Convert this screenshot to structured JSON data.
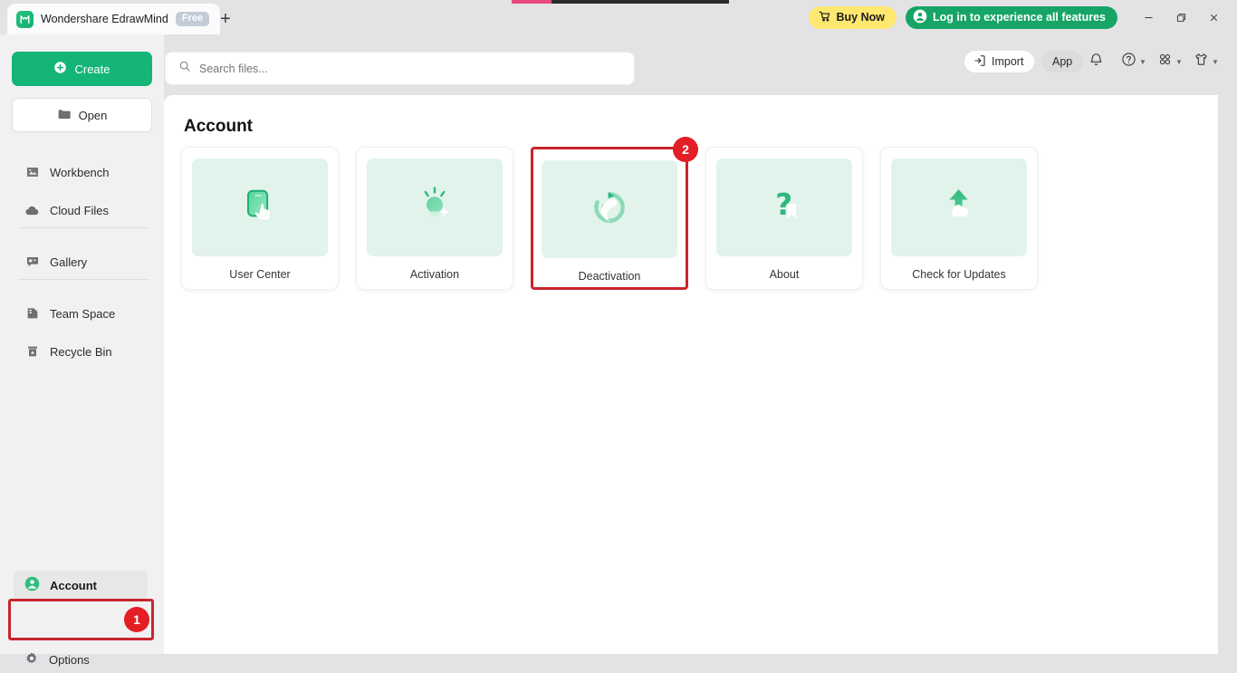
{
  "window": {
    "tab_title": "Wondershare EdrawMind",
    "tab_badge": "Free",
    "new_tab_label": "+",
    "logo_icon": "edrawmind-logo-icon",
    "buy_now_label": "Buy Now",
    "login_label": "Log in to experience all features",
    "minimize_label": "—",
    "maximize_label": "❐",
    "close_label": "✕"
  },
  "progress": {
    "pink_segment_color": "#e54a7f",
    "dark_segment_color": "#2b2b2b"
  },
  "sidebar": {
    "create_label": "Create",
    "open_label": "Open",
    "items": [
      {
        "label": "Workbench",
        "icon": "workbench-icon"
      },
      {
        "label": "Cloud Files",
        "icon": "cloud-icon"
      },
      {
        "label": "Gallery",
        "icon": "gallery-icon"
      },
      {
        "label": "Team Space",
        "icon": "team-space-icon"
      },
      {
        "label": "Recycle Bin",
        "icon": "recycle-bin-icon"
      }
    ],
    "account_label": "Account",
    "account_badge": "1",
    "options_label": "Options"
  },
  "toolbar": {
    "search_placeholder": "Search files...",
    "search_value": "",
    "import_label": "Import",
    "app_label": "App",
    "notification_icon": "bell-icon",
    "help_icon": "help-circle-icon",
    "apps_grid_icon": "apps-grid-icon",
    "theme_icon": "theme-shirt-icon"
  },
  "main": {
    "title": "Account",
    "cards": [
      {
        "label": "User Center",
        "icon": "user-center-icon",
        "highlighted": false,
        "badge": ""
      },
      {
        "label": "Activation",
        "icon": "activation-icon",
        "highlighted": false,
        "badge": ""
      },
      {
        "label": "Deactivation",
        "icon": "deactivation-icon",
        "highlighted": true,
        "badge": "2"
      },
      {
        "label": "About",
        "icon": "about-icon",
        "highlighted": false,
        "badge": ""
      },
      {
        "label": "Check for Updates",
        "icon": "check-updates-icon",
        "highlighted": false,
        "badge": ""
      }
    ]
  },
  "colors": {
    "brand_green": "#15b578",
    "accent_red": "#e31e24",
    "highlight_red": "#c9252d",
    "buy_yellow": "#ffe870"
  }
}
